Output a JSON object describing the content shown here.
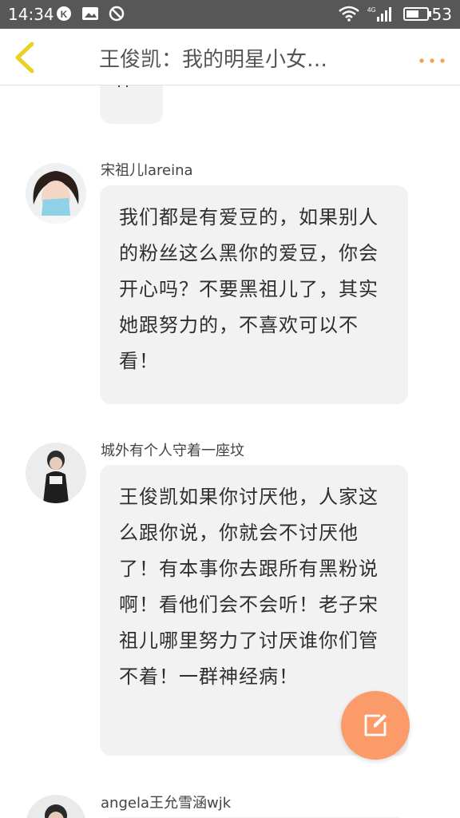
{
  "status_bar": {
    "time": "14:34",
    "signal_label": "4G",
    "battery": "53"
  },
  "header": {
    "title": "王俊凯：我的明星小女…",
    "back_icon": "chevron-left-icon",
    "more_icon": "more-dots-icon",
    "accent_color": "#f0a24f"
  },
  "comments": [
    {
      "username": "宋祖儿lareina",
      "text": "我们都是有爱豆的，如果别人的粉丝这么黑你的爱豆，你会开心吗？不要黑祖儿了，其实她跟努力的，不喜欢可以不看！"
    },
    {
      "username": "城外有个人守着一座坟",
      "text": "王俊凯如果你讨厌他，人家这么跟你说，你就会不讨厌他了！有本事你去跟所有黑粉说啊！看他们会不会听！老子宋祖儿哪里努力了讨厌谁你们管不着！一群神经病！"
    },
    {
      "username": "angela王允雪涵wjk"
    }
  ],
  "fab": {
    "icon": "compose-icon",
    "color": "#fb9b69"
  }
}
